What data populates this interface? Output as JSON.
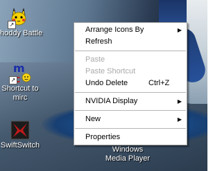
{
  "desktop_icons": [
    {
      "label": "Shoddy Battle",
      "icon": "pikachu-icon"
    },
    {
      "label_line1": "Shortcut to",
      "label_line2": "mirc",
      "icon": "mirc-icon"
    },
    {
      "label": "SwiftSwitch",
      "icon": "swiftswitch-icon"
    }
  ],
  "context_menu": {
    "items": [
      {
        "label": "Arrange Icons By",
        "submenu": true
      },
      {
        "label": "Refresh"
      },
      {
        "label": "Paste",
        "disabled": true
      },
      {
        "label": "Paste Shortcut",
        "disabled": true
      },
      {
        "label": "Undo Delete",
        "shortcut": "Ctrl+Z"
      },
      {
        "label": "NVIDIA Display",
        "submenu": true
      },
      {
        "label": "New",
        "submenu": true
      },
      {
        "label": "Properties"
      }
    ]
  },
  "wmp_icon": {
    "label_line1": "Windows",
    "label_line2": "Media Player"
  },
  "colors": {
    "menu_bg": "#ffffff",
    "disabled_text": "#a9a9a9",
    "separator": "#b5b5b5"
  }
}
